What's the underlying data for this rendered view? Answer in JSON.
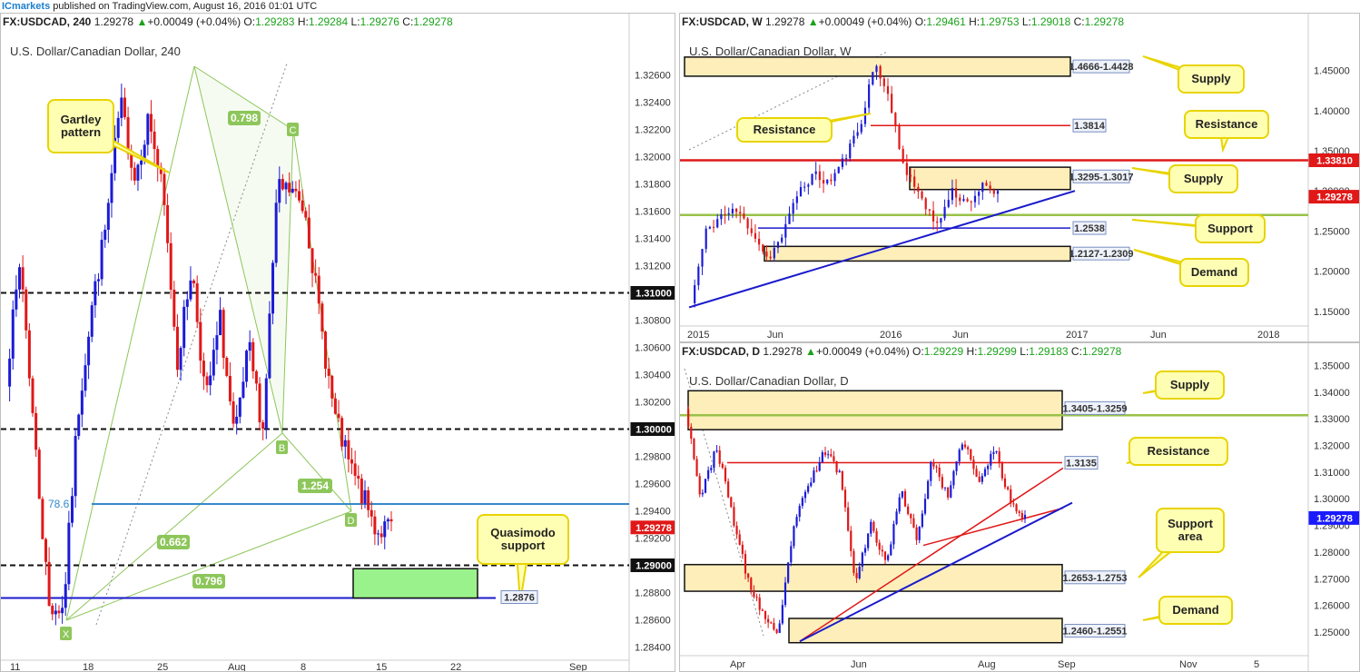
{
  "page": {
    "publisher": "ICmarkets",
    "published_text": "published on TradingView.com, August 16, 2016 01:01 UTC"
  },
  "colors": {
    "bull": "#1b1bd6",
    "bear": "#e01818",
    "zone_fill": "#fdeeba",
    "callout_fill": "#ffffb4",
    "callout_stroke": "#e8d400",
    "gartley": "#8dc65a",
    "support_line": "#1a1acc",
    "fib_line": "#3388cc",
    "price_tag": "#1a1aff",
    "resistance_tag": "#e01818",
    "green_zone": "#9af28c"
  },
  "panels": [
    {
      "id": "h4",
      "header": {
        "symbol": "FX:USDCAD, 240",
        "price": "1.29278",
        "change": "+0.00049 (+0.04%)",
        "o": "1.29283",
        "h": "1.29284",
        "l": "1.29276",
        "c": "1.29278"
      },
      "title": "U.S. Dollar/Canadian Dollar, 240",
      "labels": [
        "Gartley pattern",
        "Quasimodo support"
      ],
      "fib_labels": [
        "0.798",
        "1.254",
        "0.662",
        "0.796",
        "78.6"
      ],
      "point_labels": [
        "X",
        "B",
        "C",
        "D"
      ],
      "level_tags": [
        "1.31000",
        "1.30000",
        "1.29000",
        "1.2876"
      ],
      "current_tag": "1.29278"
    },
    {
      "id": "weekly",
      "header": {
        "symbol": "FX:USDCAD, W",
        "price": "1.29278",
        "change": "+0.00049 (+0.04%)",
        "o": "1.29461",
        "h": "1.29753",
        "l": "1.29018",
        "c": "1.29278"
      },
      "title": "U.S. Dollar/Canadian Dollar, W",
      "zone_labels": [
        "1.4666-1.4428",
        "1.3295-1.3017",
        "1.2127-1.2309"
      ],
      "line_labels": [
        "1.3814",
        "1.2538"
      ],
      "callouts": [
        "Supply",
        "Resistance",
        "Resistance",
        "Supply",
        "Support",
        "Demand"
      ],
      "resistance_tag": "1.33810",
      "current_tag": "1.29278"
    },
    {
      "id": "daily",
      "header": {
        "symbol": "FX:USDCAD, D",
        "price": "1.29278",
        "change": "+0.00049 (+0.04%)",
        "o": "1.29229",
        "h": "1.29299",
        "l": "1.29183",
        "c": "1.29278"
      },
      "title": "U.S. Dollar/Canadian Dollar, D",
      "zone_labels": [
        "1.3405-1.3259",
        "1.2653-1.2753",
        "1.2460-1.2551"
      ],
      "line_labels": [
        "1.3135"
      ],
      "callouts": [
        "Supply",
        "Resistance",
        "Support area",
        "Demand"
      ],
      "current_tag": "1.29278"
    }
  ],
  "chart_data": [
    {
      "type": "candlestick",
      "panel": "h4",
      "y_ticks": [
        "1.32600",
        "1.32400",
        "1.32200",
        "1.32000",
        "1.31800",
        "1.31600",
        "1.31400",
        "1.31200",
        "1.31000",
        "1.30800",
        "1.30600",
        "1.30400",
        "1.30200",
        "1.30000",
        "1.29800",
        "1.29600",
        "1.29400",
        "1.29200",
        "1.29000",
        "1.28800",
        "1.28600",
        "1.28400"
      ],
      "x_ticks": [
        "11",
        "18",
        "25",
        "Aug",
        "8",
        "15",
        "22",
        "Sep"
      ],
      "ylim": [
        1.2835,
        1.3285
      ],
      "levels": [
        1.31,
        1.3,
        1.29,
        1.2876,
        1.2945
      ],
      "last_close": 1.29278
    },
    {
      "type": "candlestick",
      "panel": "weekly",
      "y_ticks": [
        "1.45000",
        "1.40000",
        "1.35000",
        "1.30000",
        "1.25000",
        "1.20000",
        "1.15000"
      ],
      "x_ticks": [
        "2015",
        "Jun",
        "2016",
        "Jun",
        "2017",
        "Jun",
        "2018"
      ],
      "ylim": [
        1.125,
        1.48
      ],
      "levels": [
        1.3814,
        1.3381,
        1.2538
      ],
      "zones": [
        [
          1.4428,
          1.4666
        ],
        [
          1.3017,
          1.3295
        ],
        [
          1.2127,
          1.2309
        ]
      ],
      "last_close": 1.29278
    },
    {
      "type": "candlestick",
      "panel": "daily",
      "y_ticks": [
        "1.35000",
        "1.34000",
        "1.33000",
        "1.32000",
        "1.31000",
        "1.30000",
        "1.29000",
        "1.28000",
        "1.27000",
        "1.26000",
        "1.25000"
      ],
      "x_ticks": [
        "Apr",
        "Jun",
        "Aug",
        "Sep",
        "Nov",
        "5"
      ],
      "ylim": [
        1.2425,
        1.3515
      ],
      "levels": [
        1.3135,
        1.3313
      ],
      "zones": [
        [
          1.3259,
          1.3405
        ],
        [
          1.2653,
          1.2753
        ],
        [
          1.246,
          1.2551
        ]
      ],
      "last_close": 1.29278
    }
  ]
}
